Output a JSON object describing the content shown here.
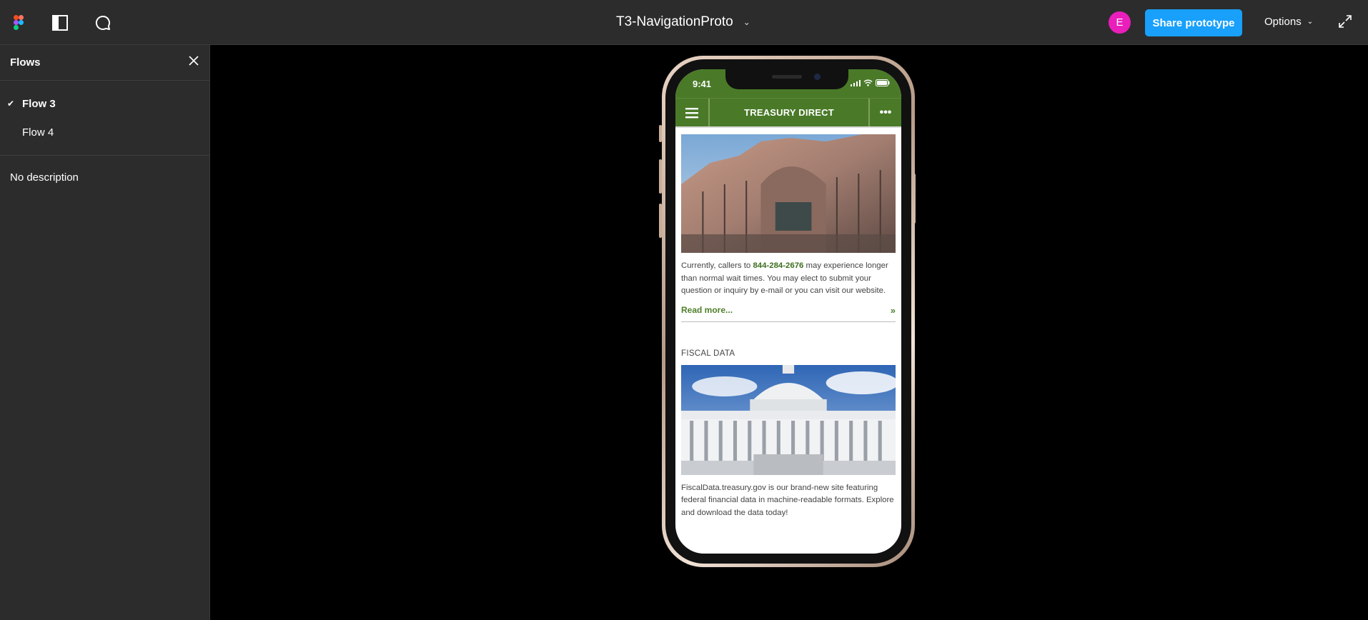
{
  "topbar": {
    "file_title": "T3-NavigationProto",
    "avatar_initial": "E",
    "share_label": "Share prototype",
    "options_label": "Options"
  },
  "sidebar": {
    "title": "Flows",
    "flows": [
      {
        "label": "Flow 3",
        "active": true
      },
      {
        "label": "Flow 4",
        "active": false
      }
    ],
    "description": "No description"
  },
  "phone": {
    "time": "9:41",
    "app_title": "TREASURY DIRECT",
    "article1": {
      "text_before": "Currently, callers to ",
      "phone_number": "844-284-2676",
      "text_after": " may experience longer than normal wait times. You may elect to submit your question or inquiry by e-mail or you can visit our website.",
      "read_more": "Read more...",
      "read_more_arrow": "»"
    },
    "section2_title": "FISCAL DATA",
    "article2_text": "FiscalData.treasury.gov is our brand-new site featuring federal financial data in machine-readable formats. Explore and download the data today!",
    "more_icon": "•••"
  },
  "colors": {
    "brand_green": "#4a7a28",
    "share_blue": "#18a0fb",
    "avatar_pink": "#e91ebb"
  }
}
